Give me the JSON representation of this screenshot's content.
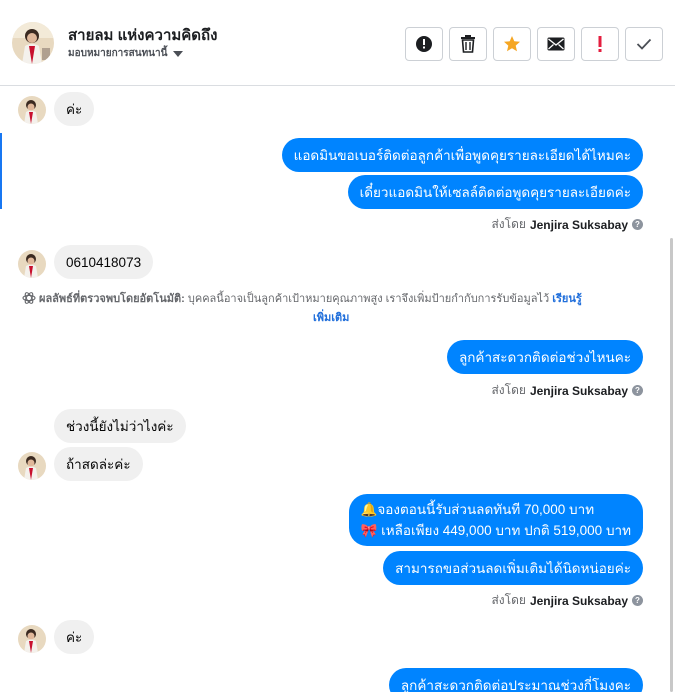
{
  "header": {
    "name": "สายลม แห่งความคิดถึง",
    "assign_label": "มอบหมายการสนทนานี้",
    "actions": [
      {
        "icon": "exclamation-circle-icon"
      },
      {
        "icon": "trash-icon"
      },
      {
        "icon": "star-icon"
      },
      {
        "icon": "envelope-icon"
      },
      {
        "icon": "red-exclamation-icon"
      },
      {
        "icon": "checkmark-icon"
      }
    ]
  },
  "messages": {
    "m1": "ค่ะ",
    "m2": "แอดมินขอเบอร์ติดต่อลูกค้าเพื่อพูดคุยรายละเอียดได้ไหมคะ",
    "m3": "เดี๋ยวแอดมินให้เซลล์ติดต่อพูดคุยรายละเอียดค่ะ",
    "sent_prefix": "ส่งโดย",
    "sender": "Jenjira Suksabay",
    "m4": "0610418073",
    "auto_label": "ผลลัพธ์ที่ตรวจพบโดยอัตโนมัติ:",
    "auto_text": "บุคคลนี้อาจเป็นลูกค้าเป้าหมายคุณภาพสูง เราจึงเพิ่มป้ายกำกับการรับข้อมูลไว้",
    "auto_link1": "เรียนรู้",
    "auto_link2": "เพิ่มเติม",
    "m5": "ลูกค้าสะดวกติดต่อช่วงไหนคะ",
    "m6": "ช่วงนี้ยังไม่ว่าไงค่ะ",
    "m7": "ถ้าสดล่ะค่ะ",
    "m8_line1": "🔔จองตอนนี้รับส่วนลดทันที 70,000 บาท",
    "m8_line2": "🎀 เหลือเพียง 449,000 บาท ปกติ 519,000 บาท",
    "m9": "สามารถขอส่วนลดเพิ่มเติมได้นิดหน่อยค่ะ",
    "m10": "ค่ะ",
    "m11": "ลูกค้าสะดวกติดต่อประมาณช่วงกี่โมงคะ"
  },
  "colors": {
    "accent": "#1877f2",
    "bubble_out": "#0084ff",
    "bubble_in": "#f0f0f0",
    "star": "#f5a623",
    "alert": "#e41e3f"
  }
}
